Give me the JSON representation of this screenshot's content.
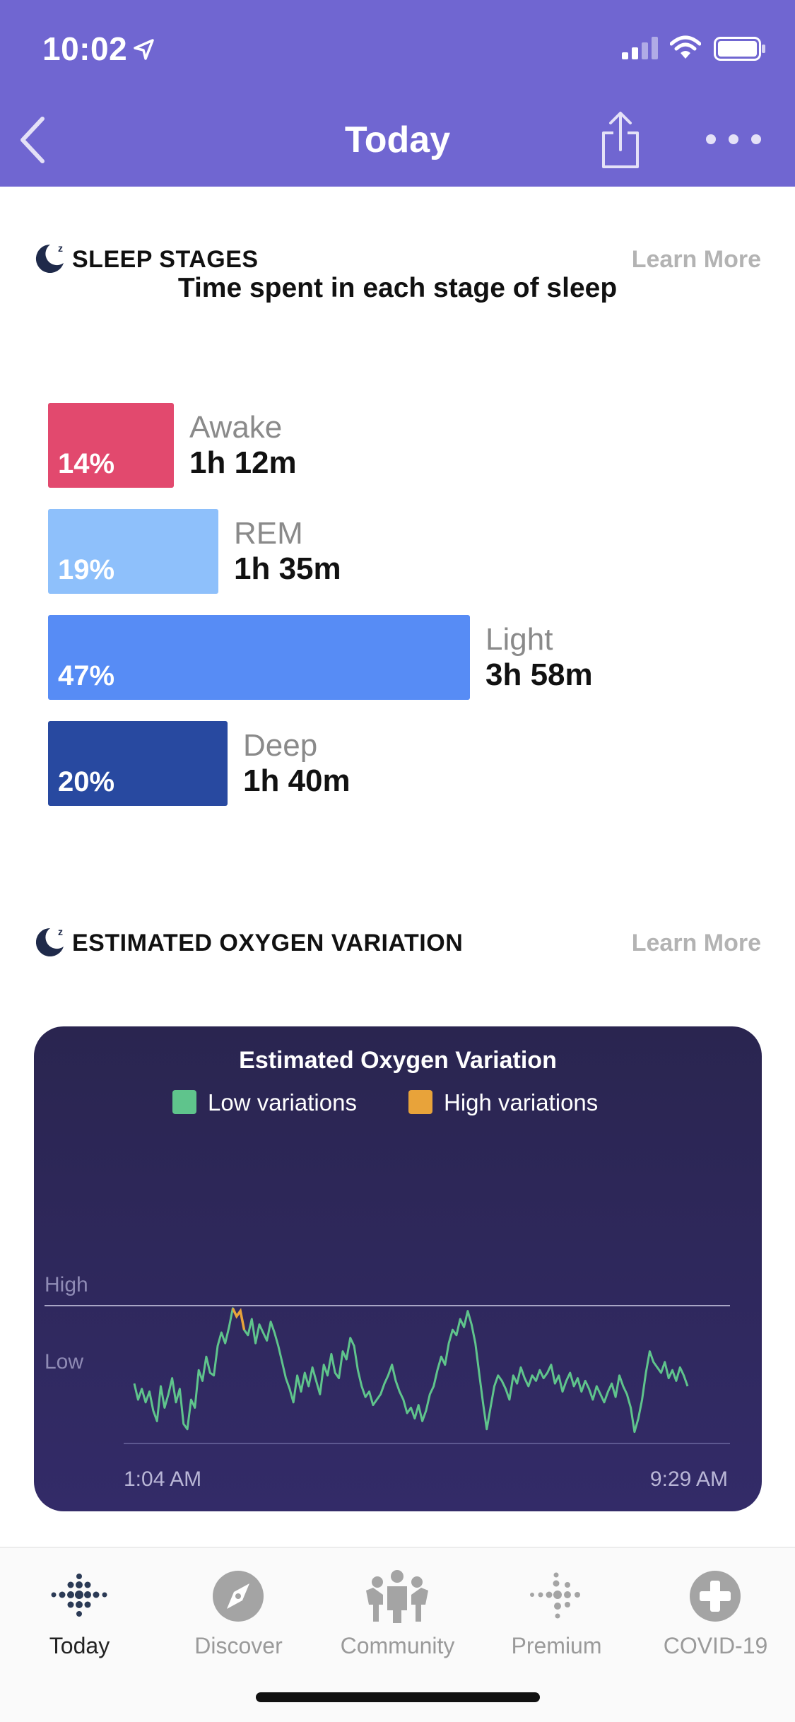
{
  "status_bar": {
    "time": "10:02"
  },
  "nav": {
    "title": "Today"
  },
  "sleep_section": {
    "title": "SLEEP STAGES",
    "learn_more": "Learn More",
    "subtitle": "Time spent in each stage of sleep",
    "stages": [
      {
        "name": "Awake",
        "percent_label": "14%",
        "percent": 14,
        "duration": "1h 12m",
        "color": "#e2496e"
      },
      {
        "name": "REM",
        "percent_label": "19%",
        "percent": 19,
        "duration": "1h 35m",
        "color": "#8ec0fb"
      },
      {
        "name": "Light",
        "percent_label": "47%",
        "percent": 47,
        "duration": "3h 58m",
        "color": "#578cf5"
      },
      {
        "name": "Deep",
        "percent_label": "20%",
        "percent": 20,
        "duration": "1h 40m",
        "color": "#2849a0"
      }
    ]
  },
  "oxygen_section": {
    "title": "ESTIMATED OXYGEN VARIATION",
    "learn_more": "Learn More"
  },
  "chart_data": {
    "type": "line",
    "title": "Estimated Oxygen Variation",
    "legend": [
      {
        "name": "Low variations",
        "color": "#5fc48c"
      },
      {
        "name": "High variations",
        "color": "#e8a33a"
      }
    ],
    "y_labels": [
      "High",
      "Low"
    ],
    "x_labels": [
      "1:04 AM",
      "9:29 AM"
    ],
    "y_range": [
      0,
      1
    ],
    "series": [
      {
        "name": "Low variations",
        "values": [
          0.42,
          0.3,
          0.38,
          0.28,
          0.36,
          0.22,
          0.14,
          0.4,
          0.24,
          0.34,
          0.46,
          0.28,
          0.38,
          0.12,
          0.08,
          0.3,
          0.24,
          0.52,
          0.44,
          0.62,
          0.5,
          0.48,
          0.7,
          0.8,
          0.72,
          0.84,
          0.98,
          0.92,
          0.96,
          0.82,
          0.78,
          0.9,
          0.72,
          0.86,
          0.8,
          0.74,
          0.88,
          0.8,
          0.7,
          0.58,
          0.46,
          0.38,
          0.28,
          0.48,
          0.36,
          0.5,
          0.4,
          0.54,
          0.44,
          0.34,
          0.56,
          0.48,
          0.64,
          0.5,
          0.46,
          0.66,
          0.6,
          0.76,
          0.7,
          0.52,
          0.4,
          0.32,
          0.36,
          0.26,
          0.3,
          0.34,
          0.42,
          0.48,
          0.56,
          0.44,
          0.36,
          0.3,
          0.2,
          0.24,
          0.16,
          0.26,
          0.14,
          0.22,
          0.34,
          0.4,
          0.52,
          0.62,
          0.56,
          0.72,
          0.82,
          0.78,
          0.9,
          0.84,
          0.96,
          0.86,
          0.72,
          0.5,
          0.28,
          0.08,
          0.24,
          0.4,
          0.48,
          0.44,
          0.38,
          0.3,
          0.48,
          0.42,
          0.54,
          0.46,
          0.4,
          0.48,
          0.44,
          0.52,
          0.46,
          0.5,
          0.56,
          0.42,
          0.48,
          0.36,
          0.44,
          0.5,
          0.4,
          0.46,
          0.36,
          0.44,
          0.38,
          0.3,
          0.4,
          0.34,
          0.28,
          0.36,
          0.42,
          0.32,
          0.48,
          0.4,
          0.34,
          0.24,
          0.06,
          0.16,
          0.3,
          0.5,
          0.66,
          0.58,
          0.54,
          0.5,
          0.58,
          0.46,
          0.52,
          0.44,
          0.54,
          0.48,
          0.4
        ],
        "high_indices": [
          26,
          27,
          28,
          29
        ]
      }
    ]
  },
  "tabs": [
    {
      "label": "Today",
      "icon": "fitbit-dots-icon",
      "active": true
    },
    {
      "label": "Discover",
      "icon": "compass-icon",
      "active": false
    },
    {
      "label": "Community",
      "icon": "community-icon",
      "active": false
    },
    {
      "label": "Premium",
      "icon": "premium-dots-icon",
      "active": false
    },
    {
      "label": "COVID-19",
      "icon": "plus-circle-icon",
      "active": false
    }
  ]
}
